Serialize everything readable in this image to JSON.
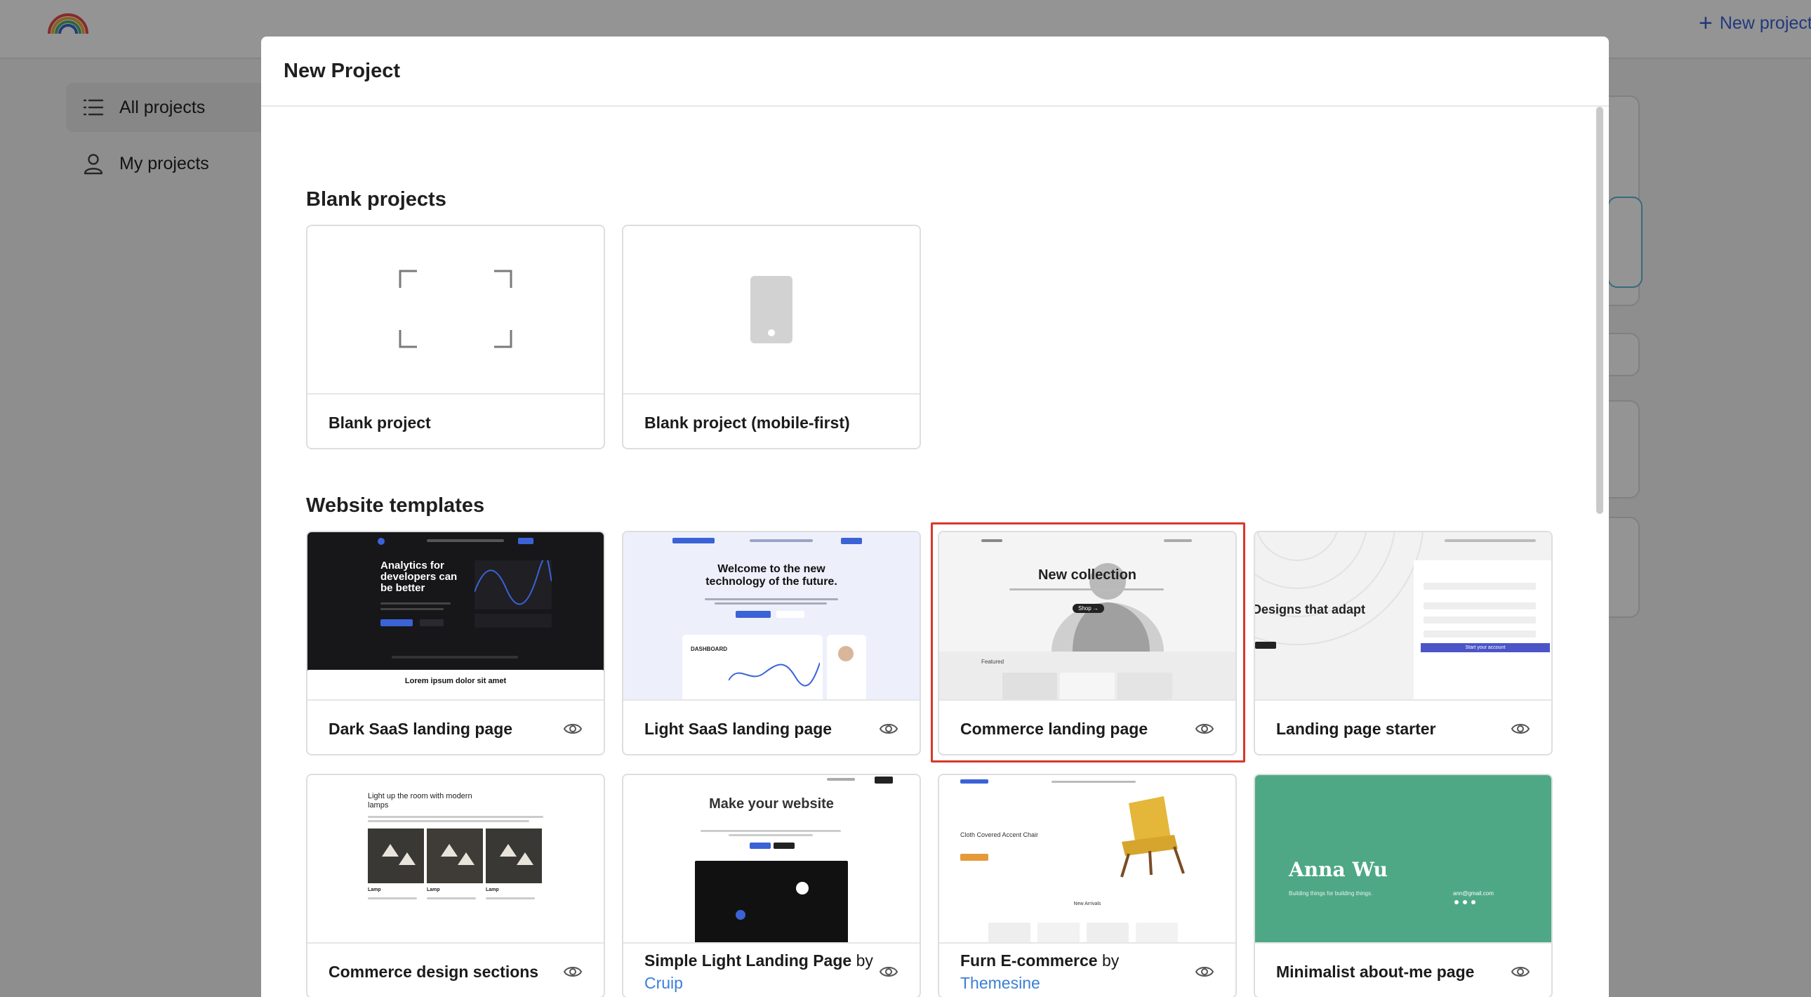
{
  "app": {
    "new_project_link": "New project",
    "sidebar": [
      {
        "label": "All projects",
        "icon": "list-icon",
        "active": true
      },
      {
        "label": "My projects",
        "icon": "user-icon",
        "active": false
      }
    ]
  },
  "modal": {
    "title": "New Project",
    "blank_section": {
      "title": "Blank projects",
      "cards": [
        {
          "label": "Blank project",
          "icon": "frame-corners-icon"
        },
        {
          "label": "Blank project (mobile-first)",
          "icon": "mobile-device-icon"
        }
      ]
    },
    "templates_section": {
      "title": "Website templates",
      "cards": [
        {
          "label": "Dark SaaS landing page",
          "by": "",
          "author": "",
          "selected": false
        },
        {
          "label": "Light SaaS landing page",
          "by": "",
          "author": "",
          "selected": false
        },
        {
          "label": "Commerce landing page",
          "by": "",
          "author": "",
          "selected": true
        },
        {
          "label": "Landing page starter",
          "by": "",
          "author": "",
          "selected": false
        },
        {
          "label": "Commerce design sections",
          "by": "",
          "author": "",
          "selected": false
        },
        {
          "label": "Simple Light Landing Page",
          "by": "by",
          "author": "Cruip",
          "selected": false
        },
        {
          "label": "Furn E-commerce",
          "by": "by",
          "author": "Themesine",
          "selected": false
        },
        {
          "label": "Minimalist about-me page",
          "by": "",
          "author": "",
          "selected": false
        }
      ]
    },
    "thumbnails": {
      "dark_saas": {
        "headline": "Analytics for developers can be better",
        "footer": "Lorem ipsum dolor sit amet"
      },
      "light_saas": {
        "headline": "Welcome to the new technology of the future.",
        "panel": "DASHBOARD"
      },
      "commerce": {
        "headline": "New collection",
        "button": "Shop →",
        "featured": "Featured"
      },
      "starter": {
        "headline": "Designs that adapt",
        "cta": "Start your account"
      },
      "commerce_sections": {
        "headline": "Light up the room with modern lamps",
        "item": "Lamp"
      },
      "simple_light": {
        "headline": "Make your website"
      },
      "furn": {
        "headline": "Cloth Covered Accent Chair",
        "section": "New Arrivals"
      },
      "about_me": {
        "name": "Anna Wu",
        "tagline": "Building things for building things.",
        "email": "ann@gmail.com"
      }
    },
    "colors": {
      "accent": "#3b63d6",
      "selection": "#d9372a",
      "link": "#3b7fd6",
      "about_green": "#4ea886"
    }
  }
}
